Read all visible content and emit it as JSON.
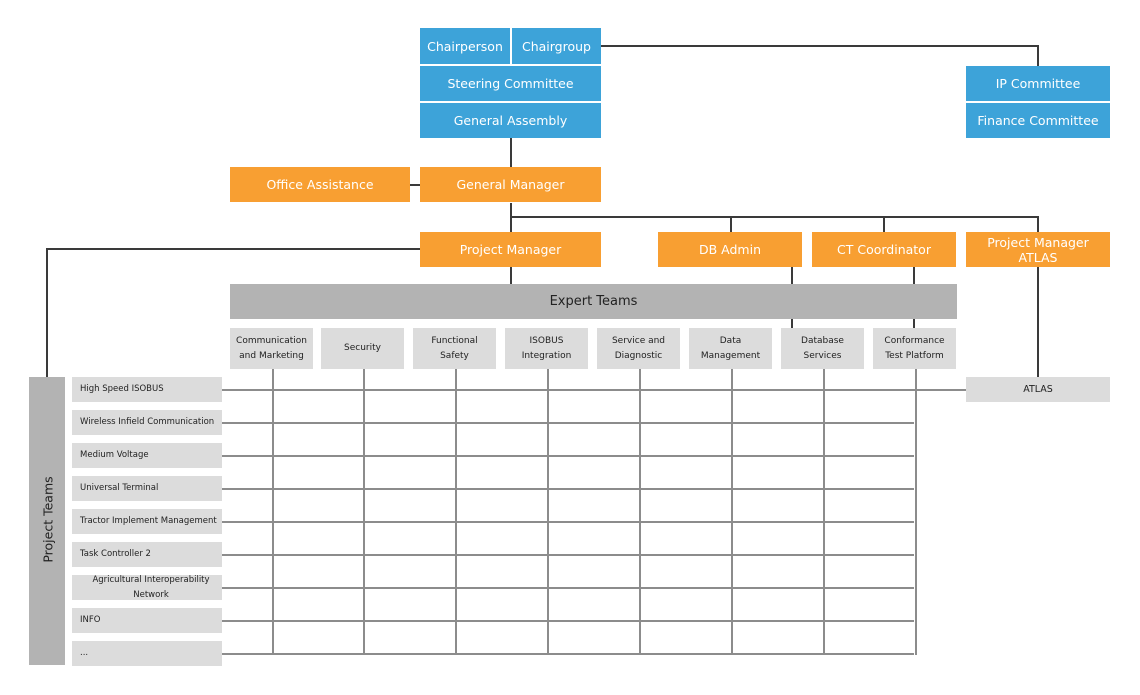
{
  "colors": {
    "governance": "#3da3d9",
    "management": "#f89f32",
    "team_header": "#b3b3b3",
    "team_cell": "#dcdcdc",
    "connector": "#3a3a3a",
    "grid": "#8c8c8c"
  },
  "governance": {
    "chairperson": "Chairperson",
    "chairgroup": "Chairgroup",
    "steering_committee": "Steering Committee",
    "general_assembly": "General Assembly",
    "ip_committee": "IP Committee",
    "finance_committee": "Finance Committee"
  },
  "management": {
    "office_assistance": "Office Assistance",
    "general_manager": "General Manager",
    "project_manager": "Project Manager",
    "db_admin": "DB Admin",
    "ct_coordinator": "CT Coordinator",
    "project_manager_atlas": "Project Manager ATLAS"
  },
  "expert_teams": {
    "title": "Expert Teams",
    "items": [
      {
        "line1": "Communication",
        "line2": "and Marketing"
      },
      {
        "line1": "Security",
        "line2": ""
      },
      {
        "line1": "Functional",
        "line2": "Safety"
      },
      {
        "line1": "ISOBUS",
        "line2": "Integration"
      },
      {
        "line1": "Service and",
        "line2": "Diagnostic"
      },
      {
        "line1": "Data",
        "line2": "Management"
      },
      {
        "line1": "Database",
        "line2": "Services"
      },
      {
        "line1": "Conformance",
        "line2": "Test Platform"
      }
    ]
  },
  "project_teams": {
    "title": "Project Teams",
    "items": [
      "High Speed ISOBUS",
      "Wireless Infield Communication",
      "Medium Voltage",
      "Universal Terminal",
      "Tractor Implement Management",
      "Task Controller 2",
      "Agricultural Interoperability Network",
      "INFO",
      "..."
    ]
  },
  "atlas": "ATLAS"
}
